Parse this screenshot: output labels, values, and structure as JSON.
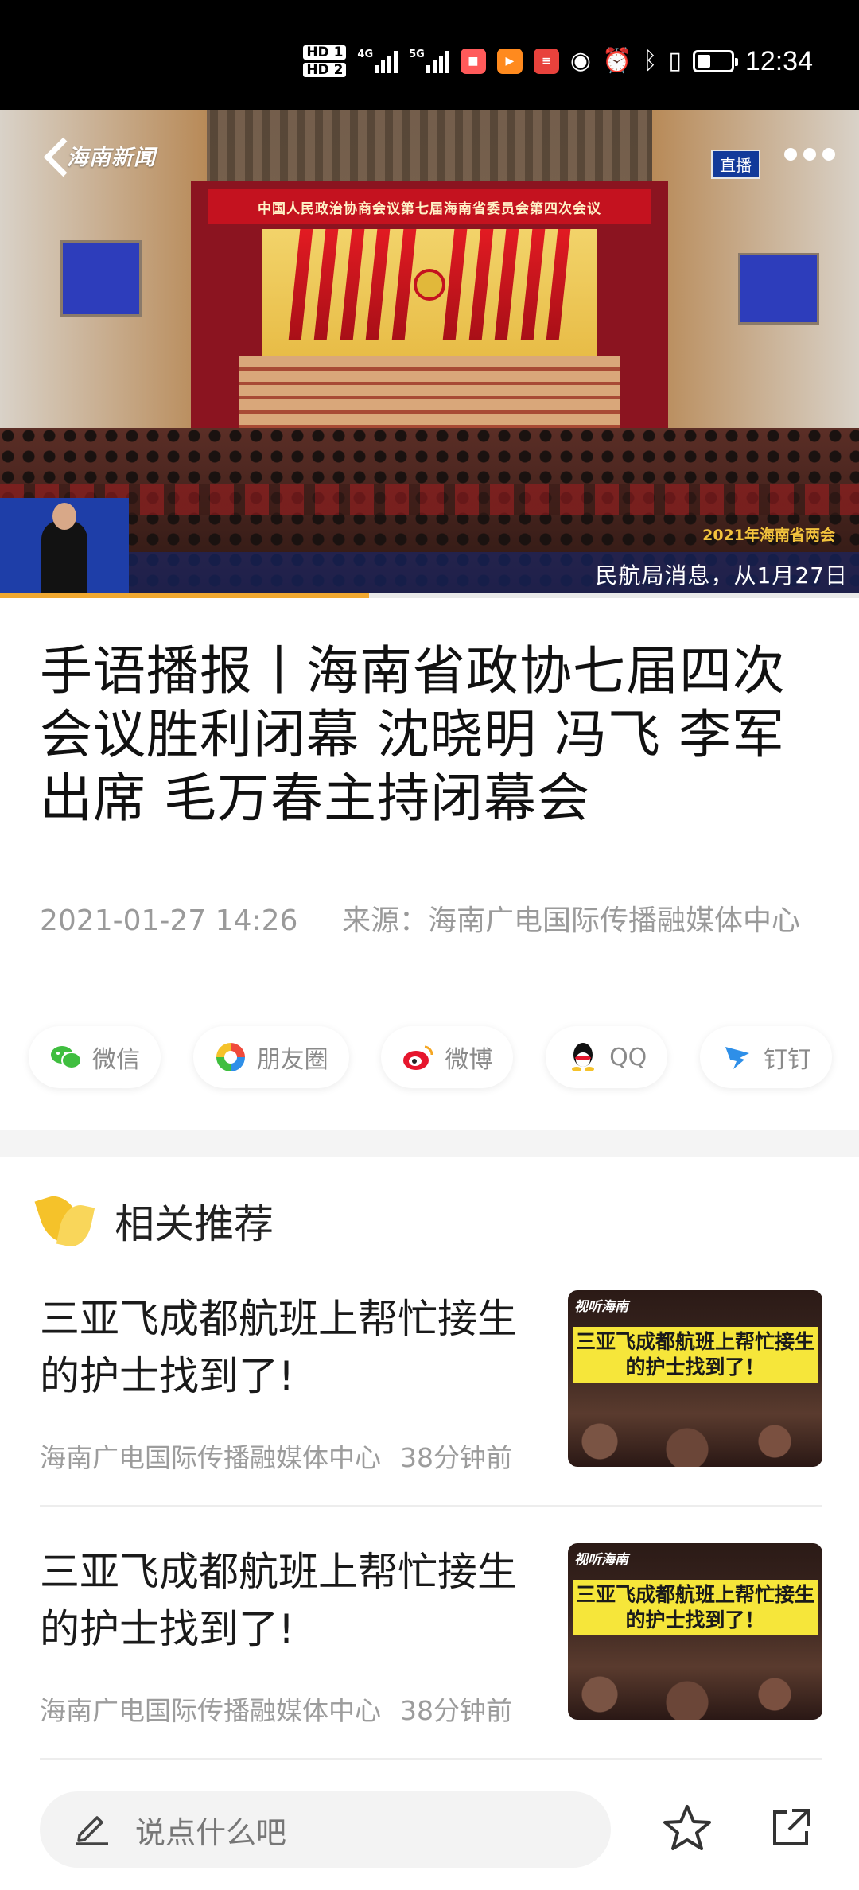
{
  "status_bar": {
    "hd1": "HD 1",
    "hd2": "HD 2",
    "net1": "4G",
    "net2": "5G",
    "time": "12:34",
    "icons": [
      "signal-4g-icon",
      "signal-5g-icon",
      "app-notification-icon",
      "video-app-icon",
      "news-app-icon",
      "eye-comfort-icon",
      "alarm-icon",
      "bluetooth-icon",
      "vibrate-icon",
      "battery-icon"
    ]
  },
  "video": {
    "logo": "海南新闻",
    "live_label": "直播",
    "hall_banner": "中国人民政治协商会议第七届海南省委员会第四次会议",
    "ticker_text": "民航局消息，从1月27日",
    "ticker_year": "2021年海南省两会",
    "progress": 0.43
  },
  "article": {
    "title": "手语播报丨海南省政协七届四次会议胜利闭幕  沈晓明 冯飞 李军出席 毛万春主持闭幕会",
    "date": "2021-01-27 14:26",
    "source": "来源：海南广电国际传播融媒体中心"
  },
  "share": [
    {
      "label": "微信",
      "icon": "wechat-icon"
    },
    {
      "label": "朋友圈",
      "icon": "moments-icon"
    },
    {
      "label": "微博",
      "icon": "weibo-icon"
    },
    {
      "label": "QQ",
      "icon": "qq-icon"
    },
    {
      "label": "钉钉",
      "icon": "dingtalk-icon"
    }
  ],
  "recommend": {
    "heading": "相关推荐",
    "items": [
      {
        "title": "三亚飞成都航班上帮忙接生的护士找到了!",
        "source": "海南广电国际传播融媒体中心",
        "time": "38分钟前",
        "thumb_logo": "视听海南",
        "thumb_caption": "三亚飞成都航班上帮忙接生的护士找到了！"
      },
      {
        "title": "三亚飞成都航班上帮忙接生的护士找到了!",
        "source": "海南广电国际传播融媒体中心",
        "time": "38分钟前",
        "thumb_logo": "视听海南",
        "thumb_caption": "三亚飞成都航班上帮忙接生的护士找到了！"
      }
    ]
  },
  "bottom_bar": {
    "comment_placeholder": "说点什么吧"
  },
  "colors": {
    "accent": "#f0a830",
    "live_badge": "#123a9a",
    "thumb_caption_bg": "#f6e63a",
    "meta_text": "#9a9a9a"
  }
}
